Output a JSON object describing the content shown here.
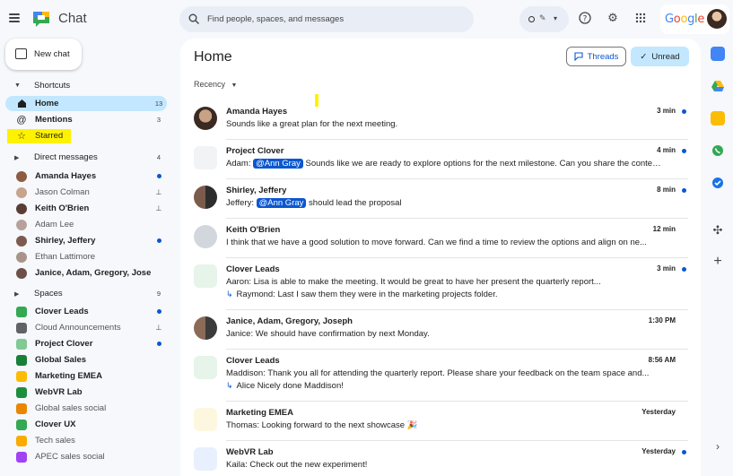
{
  "app": {
    "title": "Chat"
  },
  "search": {
    "placeholder": "Find people, spaces, and messages"
  },
  "google_logo_text": "Google",
  "colors": {
    "accent": "#0b57d0",
    "selected": "#c2e7ff",
    "highlight": "#fff200",
    "background": "#f6f8fc"
  },
  "nav": {
    "new_chat": "New chat",
    "shortcuts": {
      "label": "Shortcuts"
    },
    "home": {
      "label": "Home",
      "count": "13"
    },
    "mentions": {
      "label": "Mentions",
      "count": "3"
    },
    "starred": {
      "label": "Starred"
    },
    "direct_messages": {
      "label": "Direct messages",
      "count": "4"
    },
    "dms": [
      {
        "name": "Amanda Hayes",
        "status": "unread"
      },
      {
        "name": "Jason Colman",
        "status": "pinned"
      },
      {
        "name": "Keith O'Brien",
        "status": "pinned"
      },
      {
        "name": "Adam Lee",
        "status": ""
      },
      {
        "name": "Shirley, Jeffery",
        "status": "unread"
      },
      {
        "name": "Ethan Lattimore",
        "status": ""
      },
      {
        "name": "Janice, Adam, Gregory, Joseph",
        "status": ""
      }
    ],
    "spaces": {
      "label": "Spaces",
      "count": "9"
    },
    "space_items": [
      {
        "name": "Clover Leads",
        "status": "unread"
      },
      {
        "name": "Cloud Announcements",
        "status": "pinned"
      },
      {
        "name": "Project Clover",
        "status": "unread"
      },
      {
        "name": "Global Sales",
        "status": ""
      },
      {
        "name": "Marketing EMEA",
        "status": ""
      },
      {
        "name": "WebVR Lab",
        "status": ""
      },
      {
        "name": "Global sales social",
        "status": ""
      },
      {
        "name": "Clover UX",
        "status": ""
      },
      {
        "name": "Tech sales",
        "status": ""
      },
      {
        "name": "APEC sales social",
        "status": ""
      }
    ]
  },
  "main": {
    "title": "Home",
    "threads_label": "Threads",
    "unread_label": "Unread",
    "sort_label": "Recency",
    "conversations": [
      {
        "name": "Amanda Hayes",
        "time": "3 min",
        "unread": true,
        "line1": "Sounds like a great plan for the next meeting."
      },
      {
        "name": "Project Clover",
        "time": "4 min",
        "unread": true,
        "prefix": "Adam:",
        "mention": "@Ann Gray",
        "line1": "Sounds like we are ready to explore options for the next milestone. Can you share the context..."
      },
      {
        "name": "Shirley, Jeffery",
        "time": "8 min",
        "unread": true,
        "prefix": "Jeffery:",
        "mention": "@Ann Gray",
        "line1": "should lead the proposal"
      },
      {
        "name": "Keith O'Brien",
        "time": "12 min",
        "unread": false,
        "line1": "I think that we have a good solution to move forward. Can we find a time to review the options and align on ne..."
      },
      {
        "name": "Clover Leads",
        "time": "3 min",
        "unread": true,
        "line1": "Aaron: Lisa is able to make the meeting. It would be great to have her present the quarterly report...",
        "line2": "Raymond: Last I saw them they were in the marketing projects folder."
      },
      {
        "name": "Janice, Adam, Gregory, Joseph",
        "time": "1:30 PM",
        "unread": false,
        "line1": "Janice: We should have confirmation by next Monday."
      },
      {
        "name": "Clover Leads",
        "time": "8:56 AM",
        "unread": false,
        "line1": "Maddison: Thank you all for attending the quarterly report. Please share your feedback on the team space and...",
        "line2": "Alice Nicely done Maddison!"
      },
      {
        "name": "Marketing EMEA",
        "time": "Yesterday",
        "unread": false,
        "line1": "Thomas: Looking forward to the next showcase 🎉"
      },
      {
        "name": "WebVR Lab",
        "time": "Yesterday",
        "unread": true,
        "line1": "Kaila: Check out the new experiment!"
      }
    ]
  },
  "icons": {
    "menu": "menu-icon",
    "search": "search-icon",
    "help": "help-icon",
    "settings": "gear-icon",
    "apps": "apps-grid-icon",
    "threads": "threads-icon",
    "check": "check-icon"
  }
}
